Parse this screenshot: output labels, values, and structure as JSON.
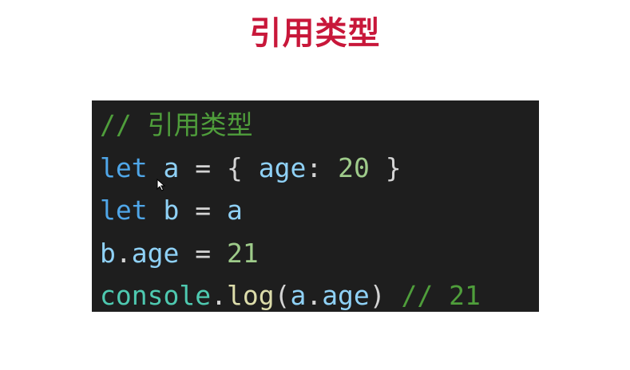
{
  "slide": {
    "title": "引用类型"
  },
  "code": {
    "line1": {
      "comment": "// 引用类型"
    },
    "line2": {
      "kw": "let",
      "var": "a",
      "eq": "=",
      "open": "{",
      "prop": "age",
      "colon": ":",
      "num": "20",
      "close": "}"
    },
    "line3": {
      "kw": "let",
      "var": "b",
      "eq": "=",
      "rhs": "a"
    },
    "line4": {
      "obj": "b",
      "dot": ".",
      "prop": "age",
      "eq": "=",
      "num": "21"
    },
    "line5": {
      "console": "console",
      "dot": ".",
      "func": "log",
      "paren_open": "(",
      "obj": "a",
      "dot2": ".",
      "prop": "age",
      "paren_close": ")",
      "comment": "// 21"
    }
  },
  "colors": {
    "title": "#c8173a",
    "panel_bg": "#1e1e1e",
    "comment": "#4f9e3b",
    "keyword": "#4fa6e8",
    "variable": "#8fd1f6",
    "number": "#9ecb8a",
    "function": "#dcdcaa",
    "console": "#4ec9b0"
  },
  "icons": {
    "cursor": "mouse-pointer-icon"
  }
}
